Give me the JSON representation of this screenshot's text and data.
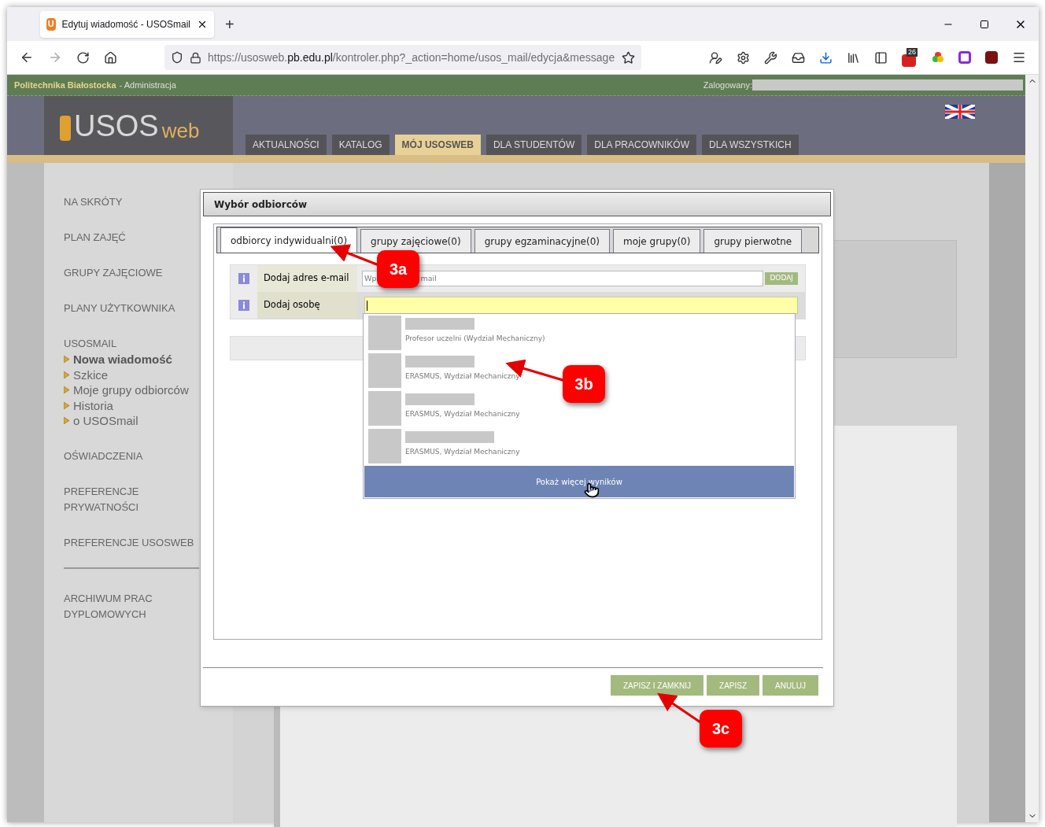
{
  "browser": {
    "tab_icon_letter": "U",
    "tab_title": "Edytuj wiadomość - USOSmail",
    "new_tab": "+",
    "url_prefix": "https://usosweb.",
    "url_domain": "pb.edu.pl",
    "url_path": "/kontroler.php?_action=home/usos_mail/edycja&message",
    "badge": "26"
  },
  "top_bar": {
    "institution": "Politechnika Białostocka",
    "section": "- Administracja",
    "logged_in_label": "Zalogowany:"
  },
  "logo": {
    "main": "USOS",
    "suffix": "web"
  },
  "nav_tabs": [
    {
      "label": "AKTUALNOŚCI",
      "selected": false
    },
    {
      "label": "KATALOG",
      "selected": false
    },
    {
      "label": "MÓJ USOSWEB",
      "selected": true
    },
    {
      "label": "DLA STUDENTÓW",
      "selected": false
    },
    {
      "label": "DLA PRACOWNIKÓW",
      "selected": false
    },
    {
      "label": "DLA WSZYSTKICH",
      "selected": false
    }
  ],
  "sidebar": {
    "items": [
      {
        "label": "NA SKRÓTY"
      },
      {
        "label": "PLAN ZAJĘĆ"
      },
      {
        "label": "GRUPY ZAJĘCIOWE"
      },
      {
        "label": "PLANY UŻYTKOWNIKA"
      },
      {
        "label": "USOSMAIL",
        "children": [
          {
            "label": "Nowa wiadomość",
            "selected": true
          },
          {
            "label": "Szkice",
            "selected": false
          },
          {
            "label": "Moje grupy odbiorców",
            "selected": false
          },
          {
            "label": "Historia",
            "selected": false
          },
          {
            "label": "o USOSmail",
            "selected": false
          }
        ]
      },
      {
        "label": "OŚWIADCZENIA"
      },
      {
        "label": "PREFERENCJE PRYWATNOŚCI"
      },
      {
        "label": "PREFERENCJE USOSWEB"
      }
    ],
    "footer_items": [
      {
        "label": "ARCHIWUM PRAC DYPLOMOWYCH"
      }
    ]
  },
  "dialog": {
    "title": "Wybór odbiorców",
    "tabs": [
      {
        "label": "odbiorcy indywidualni(0)",
        "selected": true
      },
      {
        "label": "grupy zajęciowe(0)",
        "selected": false
      },
      {
        "label": "grupy egzaminacyjne(0)",
        "selected": false
      },
      {
        "label": "moje grupy(0)",
        "selected": false
      },
      {
        "label": "grupy pierwotne",
        "selected": false
      }
    ],
    "email_row": {
      "label": "Dodaj adres e-mail",
      "placeholder": "Wp",
      "placeholder_tail": "mail",
      "button": "DODAJ"
    },
    "person_row": {
      "label": "Dodaj osobę"
    },
    "results": [
      {
        "description": "Profesor uczelni (Wydział Mechaniczny)"
      },
      {
        "description": "ERASMUS, Wydział Mechaniczny"
      },
      {
        "description": "ERASMUS, Wydział Mechaniczny"
      },
      {
        "description": "ERASMUS, Wydział Mechaniczny"
      }
    ],
    "more_button": "Pokaż więcej wyników",
    "buttons": [
      "ZAPISZ I ZAMKNIJ",
      "ZAPISZ",
      "ANULUJ"
    ]
  },
  "annotations": [
    {
      "label": "3a"
    },
    {
      "label": "3b"
    },
    {
      "label": "3c"
    }
  ]
}
